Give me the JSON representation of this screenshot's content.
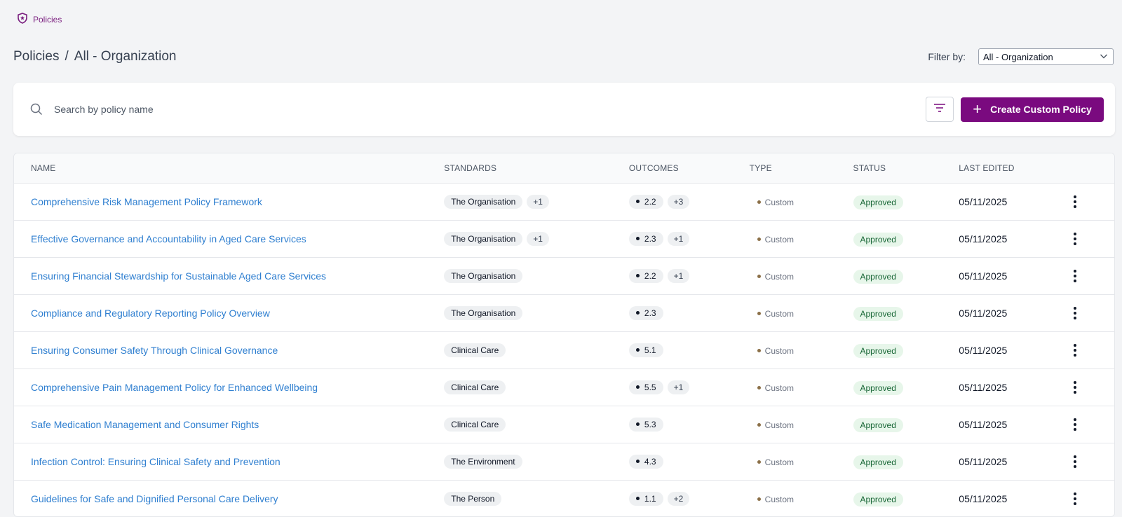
{
  "nav": {
    "section_label": "Policies",
    "icon": "shield-icon"
  },
  "header": {
    "breadcrumb_root": "Policies",
    "breadcrumb_sep": "/",
    "breadcrumb_current": "All - Organization",
    "filter_label": "Filter by:",
    "filter_value": "All - Organization"
  },
  "search": {
    "placeholder": "Search by policy name",
    "value": ""
  },
  "toolbar": {
    "create_label": "Create Custom Policy"
  },
  "colors": {
    "brand": "#7a0a7f",
    "link": "#2f7fd0",
    "approved_bg": "#e7f6ea",
    "approved_text": "#166534"
  },
  "table": {
    "headers": {
      "name": "NAME",
      "standards": "STANDARDS",
      "outcomes": "OUTCOMES",
      "type": "TYPE",
      "status": "STATUS",
      "last_edited": "LAST EDITED"
    },
    "rows": [
      {
        "name": "Comprehensive Risk Management Policy Framework",
        "standard": "The Organisation",
        "standard_more": "+1",
        "outcome": "2.2",
        "outcome_more": "+3",
        "type": "Custom",
        "status": "Approved",
        "date": "05/11/2025"
      },
      {
        "name": "Effective Governance and Accountability in Aged Care Services",
        "standard": "The Organisation",
        "standard_more": "+1",
        "outcome": "2.3",
        "outcome_more": "+1",
        "type": "Custom",
        "status": "Approved",
        "date": "05/11/2025"
      },
      {
        "name": "Ensuring Financial Stewardship for Sustainable Aged Care Services",
        "standard": "The Organisation",
        "standard_more": "",
        "outcome": "2.2",
        "outcome_more": "+1",
        "type": "Custom",
        "status": "Approved",
        "date": "05/11/2025"
      },
      {
        "name": "Compliance and Regulatory Reporting Policy Overview",
        "standard": "The Organisation",
        "standard_more": "",
        "outcome": "2.3",
        "outcome_more": "",
        "type": "Custom",
        "status": "Approved",
        "date": "05/11/2025"
      },
      {
        "name": "Ensuring Consumer Safety Through Clinical Governance",
        "standard": "Clinical Care",
        "standard_more": "",
        "outcome": "5.1",
        "outcome_more": "",
        "type": "Custom",
        "status": "Approved",
        "date": "05/11/2025"
      },
      {
        "name": "Comprehensive Pain Management Policy for Enhanced Wellbeing",
        "standard": "Clinical Care",
        "standard_more": "",
        "outcome": "5.5",
        "outcome_more": "+1",
        "type": "Custom",
        "status": "Approved",
        "date": "05/11/2025"
      },
      {
        "name": "Safe Medication Management and Consumer Rights",
        "standard": "Clinical Care",
        "standard_more": "",
        "outcome": "5.3",
        "outcome_more": "",
        "type": "Custom",
        "status": "Approved",
        "date": "05/11/2025"
      },
      {
        "name": "Infection Control: Ensuring Clinical Safety and Prevention",
        "standard": "The Environment",
        "standard_more": "",
        "outcome": "4.3",
        "outcome_more": "",
        "type": "Custom",
        "status": "Approved",
        "date": "05/11/2025"
      },
      {
        "name": "Guidelines for Safe and Dignified Personal Care Delivery",
        "standard": "The Person",
        "standard_more": "",
        "outcome": "1.1",
        "outcome_more": "+2",
        "type": "Custom",
        "status": "Approved",
        "date": "05/11/2025"
      }
    ]
  }
}
